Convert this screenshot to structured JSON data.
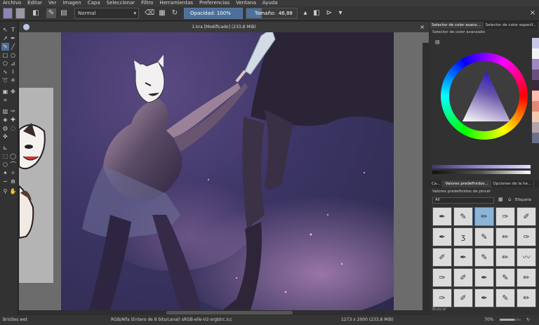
{
  "menu": [
    "Archivo",
    "Editar",
    "Ver",
    "Imagen",
    "Capa",
    "Seleccionar",
    "Filtro",
    "Herramientas",
    "Preferencias",
    "Ventana",
    "Ayuda"
  ],
  "toolbar": {
    "blend_mode": "Normal",
    "opacity_label": "Opacidad:",
    "opacity_value": "100%",
    "opacity_fraction": 1.0,
    "size_label": "Tamaño:",
    "size_value": "46,88 px",
    "fg_color": "#8d84b8",
    "bg_color": "#9a98a6"
  },
  "document": {
    "title": "1.kra [Modificado]  (233,8 MiB)"
  },
  "dock": {
    "top_tabs": [
      "Selector de color avanz...",
      "Selector de color especif..."
    ],
    "color_panel_title": "Selector de color avanzado",
    "mid_tabs": [
      "Ca...",
      "Valores predefinidos...",
      "Opciones de la he..."
    ],
    "presets_title": "Valores predefinidos de pincel",
    "filter_value": "All",
    "tag_label": "Etiqueta",
    "search_placeholder": "Buscar",
    "preset_icons": [
      "✒",
      "✎",
      "✏",
      "✑",
      "✐",
      "✒",
      "ʒ",
      "✎",
      "✏",
      "✑",
      "✐",
      "✒",
      "✎",
      "✏",
      "〰",
      "✑",
      "✐",
      "✒",
      "✎",
      "✏",
      "✑",
      "✐",
      "✒",
      "✎",
      "✏"
    ]
  },
  "status": {
    "brush": "Bristles wet",
    "color_space": "RGB/Alfa (Entero de 8 bits/canal)  sRGB-elle-V2-srgbtrc.icc",
    "dimensions": "1273 x 2000 (233,8 MiB)",
    "zoom": "70%"
  }
}
